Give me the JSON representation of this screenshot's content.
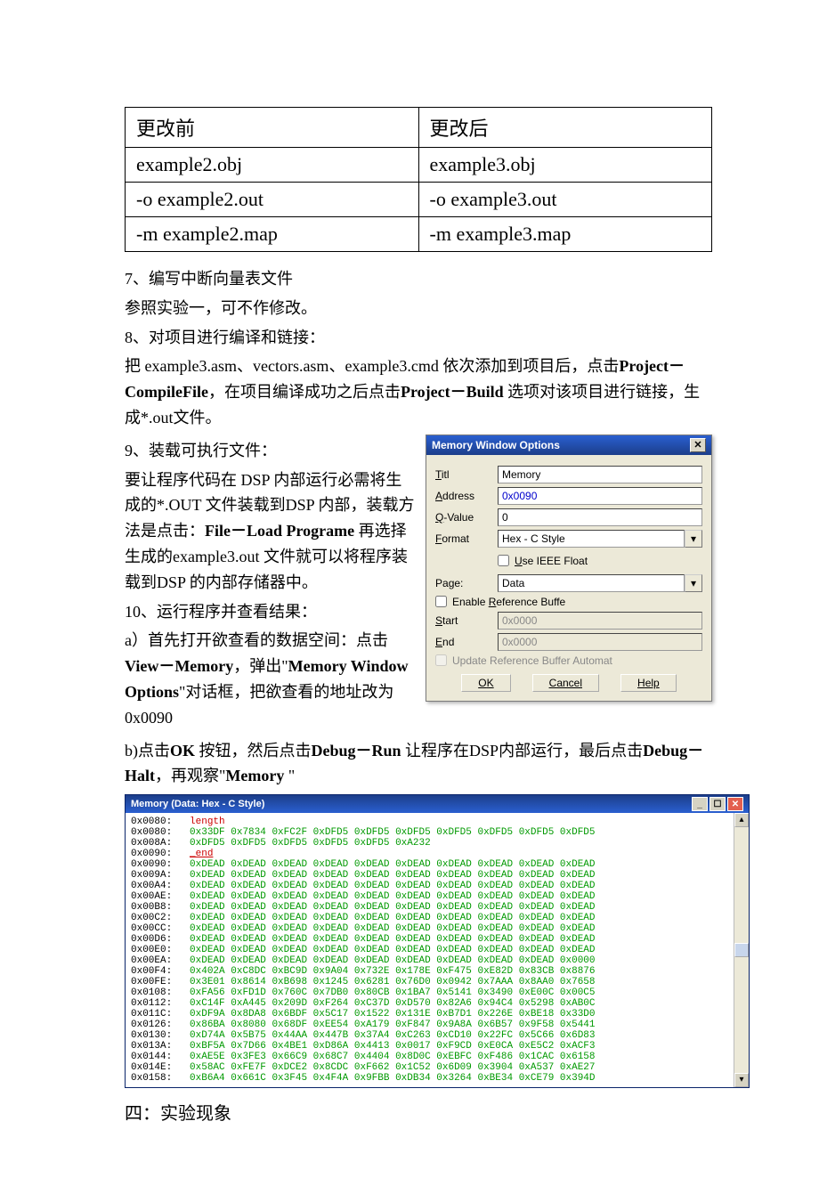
{
  "table": {
    "h1": "更改前",
    "h2": "更改后",
    "r1a": "example2.obj",
    "r1b": "example3.obj",
    "r2a": "-o example2.out",
    "r2b": "-o example3.out",
    "r3a": "-m example2.map",
    "r3b": "-m example3.map"
  },
  "p7": "7、编写中断向量表文件",
  "p7b": "参照实验一，可不作修改。",
  "p8": "8、对项目进行编译和链接：",
  "p8b_pre": "把 example3.asm、vectors.asm、example3.cmd 依次添加到项目后，点击",
  "p8b_b1": "Project－CompileFile",
  "p8b_mid": "，在项目编译成功之后点击",
  "p8b_b2": "Project－Build",
  "p8b_end": " 选项对该项目进行链接，生成*.out文件。",
  "p9": "9、装载可执行文件：",
  "p9b_pre": "要让程序代码在 DSP 内部运行必需将生成的*.OUT 文件装载到DSP 内部，装载方法是点击：",
  "p9b_b1": "File－Load Programe",
  "p9b_end": " 再选择生成的example3.out 文件就可以将程序装载到DSP 的内部存储器中。",
  "p10": "10、运行程序并查看结果：",
  "p10a_pre": "a）首先打开欲查看的数据空间：点击",
  "p10a_b1": "View－Memory",
  "p10a_mid": "，弹出\"",
  "p10a_b2": "Memory Window Options",
  "p10a_end": "\"对话框，把欲查看的地址改为0x0090",
  "pb_pre": "b)点击",
  "pb_b1": "OK",
  "pb_mid1": " 按钮，然后点击",
  "pb_b2": "Debug－Run",
  "pb_mid2": " 让程序在DSP内部运行，最后点击",
  "pb_b3": "Debug－Halt",
  "pb_end": "，再观察\"",
  "pb_b4": "Memory",
  "pb_end2": " \"",
  "dlg": {
    "title": "Memory Window Options",
    "titl_label": "Titl",
    "titl_val": "Memory",
    "addr_label": "Address",
    "addr_val": "0x0090",
    "q_label": "Q-Value",
    "q_val": "0",
    "fmt_label": "Format",
    "fmt_val": "Hex - C Style",
    "ieee": "Use IEEE Float",
    "page_label": "Page:",
    "page_val": "Data",
    "enable_ref": "Enable Reference Buffe",
    "start_label": "Start",
    "start_val": "0x0000",
    "end_label": "End",
    "end_val": "0x0000",
    "update_ref": "Update Reference Buffer Automat",
    "ok": "OK",
    "cancel": "Cancel",
    "help": "Help"
  },
  "mem": {
    "title": "Memory (Data: Hex - C Style)",
    "rows": [
      {
        "addr": "0x0080:",
        "label": "length"
      },
      {
        "addr": "0x0080:",
        "vals": [
          "0x33DF",
          "0x7834",
          "0xFC2F",
          "0xDFD5",
          "0xDFD5",
          "0xDFD5",
          "0xDFD5",
          "0xDFD5",
          "0xDFD5",
          "0xDFD5"
        ]
      },
      {
        "addr": "0x008A:",
        "vals": [
          "0xDFD5",
          "0xDFD5",
          "0xDFD5",
          "0xDFD5",
          "0xDFD5",
          "0xA232"
        ]
      },
      {
        "addr": "0x0090:",
        "label": "_end"
      },
      {
        "addr": "0x0090:",
        "vals": [
          "0xDEAD",
          "0xDEAD",
          "0xDEAD",
          "0xDEAD",
          "0xDEAD",
          "0xDEAD",
          "0xDEAD",
          "0xDEAD",
          "0xDEAD",
          "0xDEAD"
        ]
      },
      {
        "addr": "0x009A:",
        "vals": [
          "0xDEAD",
          "0xDEAD",
          "0xDEAD",
          "0xDEAD",
          "0xDEAD",
          "0xDEAD",
          "0xDEAD",
          "0xDEAD",
          "0xDEAD",
          "0xDEAD"
        ]
      },
      {
        "addr": "0x00A4:",
        "vals": [
          "0xDEAD",
          "0xDEAD",
          "0xDEAD",
          "0xDEAD",
          "0xDEAD",
          "0xDEAD",
          "0xDEAD",
          "0xDEAD",
          "0xDEAD",
          "0xDEAD"
        ]
      },
      {
        "addr": "0x00AE:",
        "vals": [
          "0xDEAD",
          "0xDEAD",
          "0xDEAD",
          "0xDEAD",
          "0xDEAD",
          "0xDEAD",
          "0xDEAD",
          "0xDEAD",
          "0xDEAD",
          "0xDEAD"
        ]
      },
      {
        "addr": "0x00B8:",
        "vals": [
          "0xDEAD",
          "0xDEAD",
          "0xDEAD",
          "0xDEAD",
          "0xDEAD",
          "0xDEAD",
          "0xDEAD",
          "0xDEAD",
          "0xDEAD",
          "0xDEAD"
        ]
      },
      {
        "addr": "0x00C2:",
        "vals": [
          "0xDEAD",
          "0xDEAD",
          "0xDEAD",
          "0xDEAD",
          "0xDEAD",
          "0xDEAD",
          "0xDEAD",
          "0xDEAD",
          "0xDEAD",
          "0xDEAD"
        ]
      },
      {
        "addr": "0x00CC:",
        "vals": [
          "0xDEAD",
          "0xDEAD",
          "0xDEAD",
          "0xDEAD",
          "0xDEAD",
          "0xDEAD",
          "0xDEAD",
          "0xDEAD",
          "0xDEAD",
          "0xDEAD"
        ]
      },
      {
        "addr": "0x00D6:",
        "vals": [
          "0xDEAD",
          "0xDEAD",
          "0xDEAD",
          "0xDEAD",
          "0xDEAD",
          "0xDEAD",
          "0xDEAD",
          "0xDEAD",
          "0xDEAD",
          "0xDEAD"
        ]
      },
      {
        "addr": "0x00E0:",
        "vals": [
          "0xDEAD",
          "0xDEAD",
          "0xDEAD",
          "0xDEAD",
          "0xDEAD",
          "0xDEAD",
          "0xDEAD",
          "0xDEAD",
          "0xDEAD",
          "0xDEAD"
        ]
      },
      {
        "addr": "0x00EA:",
        "vals": [
          "0xDEAD",
          "0xDEAD",
          "0xDEAD",
          "0xDEAD",
          "0xDEAD",
          "0xDEAD",
          "0xDEAD",
          "0xDEAD",
          "0xDEAD",
          "0x0000"
        ]
      },
      {
        "addr": "0x00F4:",
        "vals": [
          "0x402A",
          "0xC8DC",
          "0xBC9D",
          "0x9A04",
          "0x732E",
          "0x178E",
          "0xF475",
          "0xE82D",
          "0x83CB",
          "0x8876"
        ]
      },
      {
        "addr": "0x00FE:",
        "vals": [
          "0x3E01",
          "0x8614",
          "0xB698",
          "0x1245",
          "0x6281",
          "0x76D0",
          "0x0942",
          "0x7AAA",
          "0x8AA0",
          "0x7658"
        ]
      },
      {
        "addr": "0x0108:",
        "vals": [
          "0xFA56",
          "0xFD1D",
          "0x760C",
          "0x7DB0",
          "0x80CB",
          "0x1BA7",
          "0x5141",
          "0x3490",
          "0xE00C",
          "0x00C5"
        ]
      },
      {
        "addr": "0x0112:",
        "vals": [
          "0xC14F",
          "0xA445",
          "0x209D",
          "0xF264",
          "0xC37D",
          "0xD570",
          "0x82A6",
          "0x94C4",
          "0x5298",
          "0xAB0C"
        ]
      },
      {
        "addr": "0x011C:",
        "vals": [
          "0xDF9A",
          "0x8DA8",
          "0x6BDF",
          "0x5C17",
          "0x1522",
          "0x131E",
          "0xB7D1",
          "0x226E",
          "0xBE18",
          "0x33D0"
        ]
      },
      {
        "addr": "0x0126:",
        "vals": [
          "0x86BA",
          "0x8080",
          "0x68DF",
          "0xEE54",
          "0xA179",
          "0xF847",
          "0x9A8A",
          "0x6B57",
          "0x9F58",
          "0x5441"
        ]
      },
      {
        "addr": "0x0130:",
        "vals": [
          "0xD74A",
          "0x5B75",
          "0x44AA",
          "0x447B",
          "0x37A4",
          "0xC263",
          "0xCD10",
          "0x22FC",
          "0x5C66",
          "0x6D83"
        ]
      },
      {
        "addr": "0x013A:",
        "vals": [
          "0xBF5A",
          "0x7D66",
          "0x4BE1",
          "0xD86A",
          "0x4413",
          "0x0017",
          "0xF9CD",
          "0xE0CA",
          "0xE5C2",
          "0xACF3"
        ]
      },
      {
        "addr": "0x0144:",
        "vals": [
          "0xAE5E",
          "0x3FE3",
          "0x66C9",
          "0x68C7",
          "0x4404",
          "0x8D0C",
          "0xEBFC",
          "0xF486",
          "0x1CAC",
          "0x6158"
        ]
      },
      {
        "addr": "0x014E:",
        "vals": [
          "0x58AC",
          "0xFE7F",
          "0xDCE2",
          "0x8CDC",
          "0xF662",
          "0x1C52",
          "0x6D09",
          "0x3904",
          "0xA537",
          "0xAE27"
        ]
      },
      {
        "addr": "0x0158:",
        "vals": [
          "0xB6A4",
          "0x661C",
          "0x3F45",
          "0x4F4A",
          "0x9FBB",
          "0xDB34",
          "0x3264",
          "0xBE34",
          "0xCE79",
          "0x394D"
        ]
      }
    ]
  },
  "section4": "四：实验现象"
}
